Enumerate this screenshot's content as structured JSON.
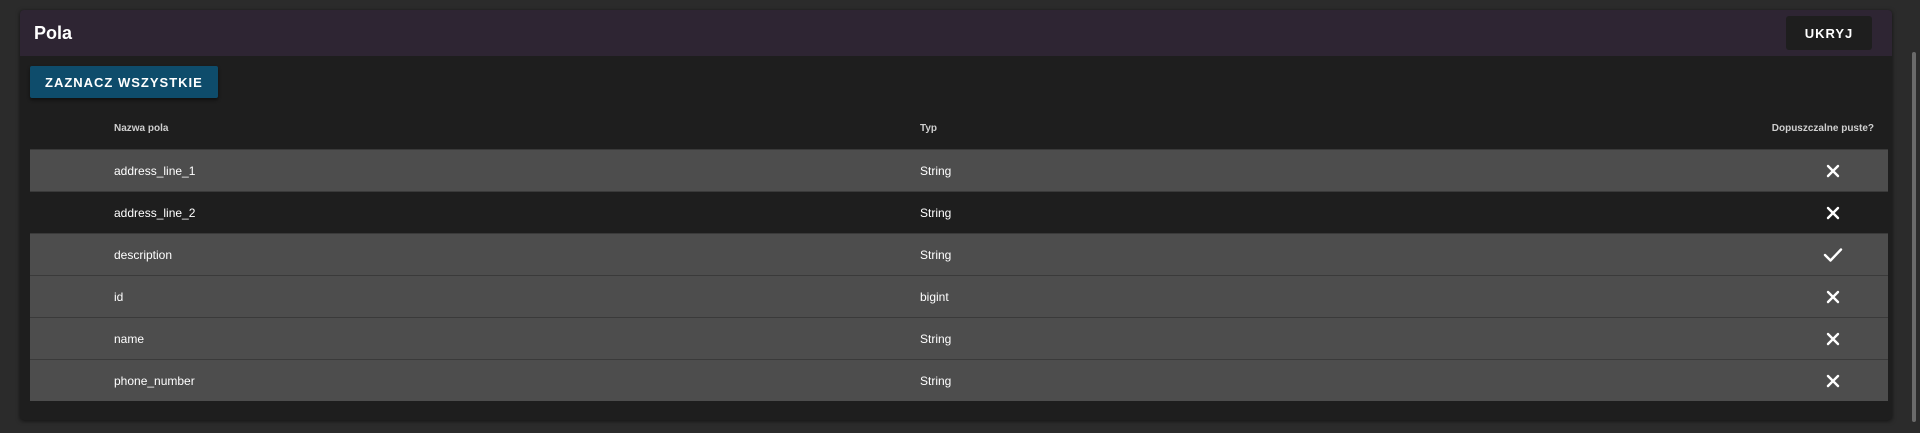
{
  "header": {
    "title": "Pola",
    "hide_label": "UKRYJ"
  },
  "toolbar": {
    "select_all_label": "ZAZNACZ WSZYSTKIE"
  },
  "table": {
    "columns": [
      "Nazwa pola",
      "Typ",
      "Dopuszczalne puste?"
    ],
    "rows": [
      {
        "name": "address_line_1",
        "type": "String",
        "nullable": false,
        "icon": "close-icon"
      },
      {
        "name": "address_line_2",
        "type": "String",
        "nullable": false,
        "icon": "close-icon"
      },
      {
        "name": "description",
        "type": "String",
        "nullable": true,
        "icon": "check-icon"
      },
      {
        "name": "id",
        "type": "bigint",
        "nullable": false,
        "icon": "close-icon"
      },
      {
        "name": "name",
        "type": "String",
        "nullable": false,
        "icon": "close-icon"
      },
      {
        "name": "phone_number",
        "type": "String",
        "nullable": false,
        "icon": "close-icon"
      }
    ]
  },
  "colors": {
    "header_bg": "#2e2533",
    "primary_button": "#0e4c6b",
    "row_odd": "#4d4d4d",
    "row_even": "#1e1e1e"
  }
}
